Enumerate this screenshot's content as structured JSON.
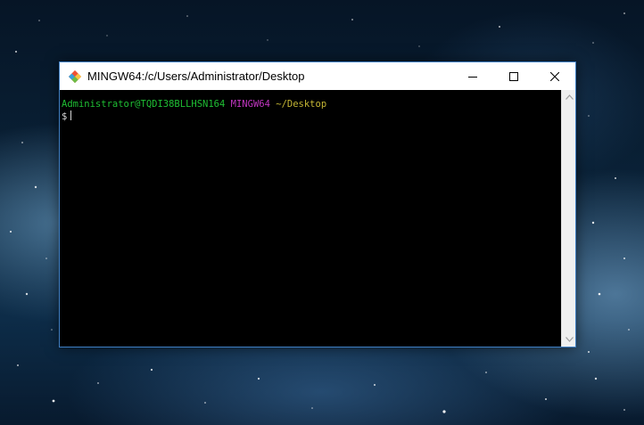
{
  "window": {
    "title": "MINGW64:/c/Users/Administrator/Desktop",
    "app_icon": "git-icon",
    "controls": [
      "minimize-icon",
      "maximize-icon",
      "close-icon"
    ]
  },
  "terminal": {
    "prompt_user": "Administrator@TQDI38BLLHSN164",
    "prompt_system": "MINGW64",
    "prompt_path": "~/Desktop",
    "prompt_symbol": "$"
  },
  "colors": {
    "user": "#1fbf34",
    "system": "#c036c0",
    "path": "#c6b735",
    "terminal_bg": "#000000",
    "window_border": "#3f7fc4"
  }
}
